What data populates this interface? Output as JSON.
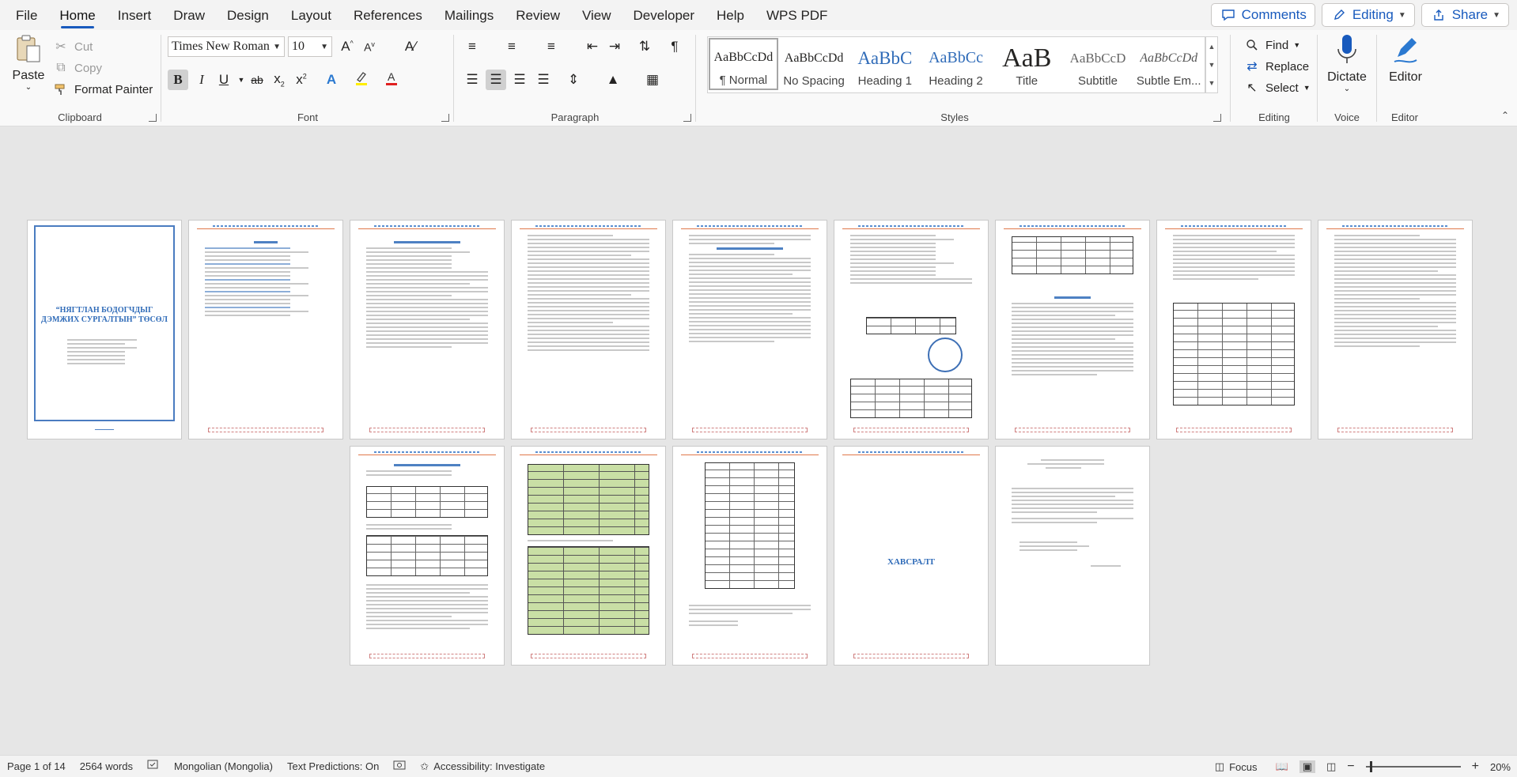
{
  "menu": {
    "tabs": [
      "File",
      "Home",
      "Insert",
      "Draw",
      "Design",
      "Layout",
      "References",
      "Mailings",
      "Review",
      "View",
      "Developer",
      "Help",
      "WPS PDF"
    ],
    "active": "Home",
    "comments": "Comments",
    "editing": "Editing",
    "share": "Share"
  },
  "clipboard": {
    "paste": "Paste",
    "cut": "Cut",
    "copy": "Copy",
    "format_painter": "Format Painter",
    "label": "Clipboard"
  },
  "font": {
    "name": "Times New Roman",
    "size": "10",
    "label": "Font"
  },
  "paragraph": {
    "label": "Paragraph"
  },
  "styles": {
    "label": "Styles",
    "items": [
      {
        "preview": "AaBbCcDd",
        "name": "¶ Normal"
      },
      {
        "preview": "AaBbCcDd",
        "name": "No Spacing"
      },
      {
        "preview": "AaBbC",
        "name": "Heading 1"
      },
      {
        "preview": "AaBbCc",
        "name": "Heading 2"
      },
      {
        "preview": "AaB",
        "name": "Title"
      },
      {
        "preview": "AaBbCcD",
        "name": "Subtitle"
      },
      {
        "preview": "AaBbCcDd",
        "name": "Subtle Em..."
      }
    ]
  },
  "editing_group": {
    "find": "Find",
    "replace": "Replace",
    "select": "Select",
    "label": "Editing"
  },
  "voice": {
    "dictate": "Dictate",
    "label": "Voice"
  },
  "editor": {
    "button": "Editor",
    "label": "Editor"
  },
  "document": {
    "cover_title": "“НЯГТЛАН БОДОГЧДЫГ ДЭМЖИХ СУРГАЛТЫН” ТӨСӨЛ",
    "last_page_title": "ХАВСРАЛТ"
  },
  "status": {
    "page": "Page 1 of 14",
    "words": "2564 words",
    "language": "Mongolian (Mongolia)",
    "predictions": "Text Predictions: On",
    "accessibility": "Accessibility: Investigate",
    "focus": "Focus",
    "zoom": "20%",
    "zoom_level": 0.2
  },
  "colors": {
    "accent": "#185abd",
    "heading_blue": "#2f6bb8"
  }
}
